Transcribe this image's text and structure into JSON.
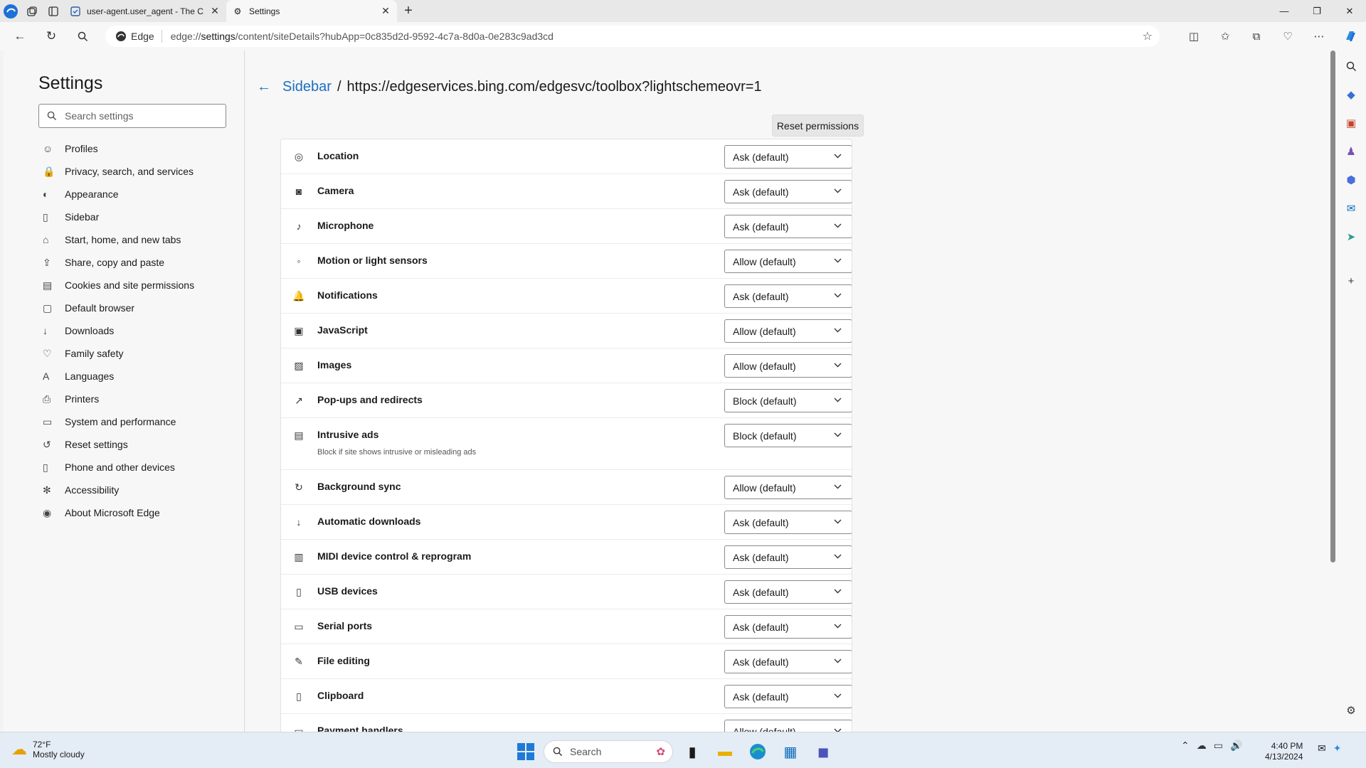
{
  "browser": {
    "tabs": [
      {
        "label": "user-agent.user_agent - The Coll",
        "active": false
      },
      {
        "label": "Settings",
        "active": true
      }
    ],
    "site_chip": "Edge",
    "url_prefix": "edge://",
    "url_host": "settings",
    "url_rest": "/content/siteDetails?hubApp=0c835d2d-9592-4c7a-8d0a-0e283c9ad3cd"
  },
  "settings": {
    "title": "Settings",
    "search_placeholder": "Search settings",
    "nav": [
      {
        "label": "Profiles",
        "icon": "profile-icon"
      },
      {
        "label": "Privacy, search, and services",
        "icon": "lock-icon"
      },
      {
        "label": "Appearance",
        "icon": "appearance-icon"
      },
      {
        "label": "Sidebar",
        "icon": "sidebar-icon"
      },
      {
        "label": "Start, home, and new tabs",
        "icon": "home-icon"
      },
      {
        "label": "Share, copy and paste",
        "icon": "share-icon"
      },
      {
        "label": "Cookies and site permissions",
        "icon": "cookies-icon"
      },
      {
        "label": "Default browser",
        "icon": "browser-icon"
      },
      {
        "label": "Downloads",
        "icon": "download-icon"
      },
      {
        "label": "Family safety",
        "icon": "family-icon"
      },
      {
        "label": "Languages",
        "icon": "languages-icon"
      },
      {
        "label": "Printers",
        "icon": "printer-icon"
      },
      {
        "label": "System and performance",
        "icon": "system-icon"
      },
      {
        "label": "Reset settings",
        "icon": "reset-icon"
      },
      {
        "label": "Phone and other devices",
        "icon": "phone-icon"
      },
      {
        "label": "Accessibility",
        "icon": "accessibility-icon"
      },
      {
        "label": "About Microsoft Edge",
        "icon": "edge-logo-icon"
      }
    ]
  },
  "main": {
    "breadcrumb_link": "Sidebar",
    "breadcrumb_sep": "/",
    "breadcrumb_current": "https://edgeservices.bing.com/edgesvc/toolbox?lightschemeovr=1",
    "reset_label": "Reset permissions",
    "permissions": [
      {
        "label": "Location",
        "value": "Ask (default)",
        "icon": "location-icon"
      },
      {
        "label": "Camera",
        "value": "Ask (default)",
        "icon": "camera-icon"
      },
      {
        "label": "Microphone",
        "value": "Ask (default)",
        "icon": "microphone-icon"
      },
      {
        "label": "Motion or light sensors",
        "value": "Allow (default)",
        "icon": "sensor-icon"
      },
      {
        "label": "Notifications",
        "value": "Ask (default)",
        "icon": "bell-icon"
      },
      {
        "label": "JavaScript",
        "value": "Allow (default)",
        "icon": "javascript-icon"
      },
      {
        "label": "Images",
        "value": "Allow (default)",
        "icon": "image-icon"
      },
      {
        "label": "Pop-ups and redirects",
        "value": "Block (default)",
        "icon": "popup-icon"
      },
      {
        "label": "Intrusive ads",
        "value": "Block (default)",
        "icon": "ads-icon",
        "sub": "Block if site shows intrusive or misleading ads"
      },
      {
        "label": "Background sync",
        "value": "Allow (default)",
        "icon": "sync-icon"
      },
      {
        "label": "Automatic downloads",
        "value": "Ask (default)",
        "icon": "download-icon"
      },
      {
        "label": "MIDI device control & reprogram",
        "value": "Ask (default)",
        "icon": "midi-icon"
      },
      {
        "label": "USB devices",
        "value": "Ask (default)",
        "icon": "usb-icon"
      },
      {
        "label": "Serial ports",
        "value": "Ask (default)",
        "icon": "serial-port-icon"
      },
      {
        "label": "File editing",
        "value": "Ask (default)",
        "icon": "file-edit-icon"
      },
      {
        "label": "Clipboard",
        "value": "Ask (default)",
        "icon": "clipboard-icon"
      },
      {
        "label": "Payment handlers",
        "value": "Allow (default)",
        "icon": "payment-icon"
      }
    ]
  },
  "taskbar": {
    "temperature": "72°F",
    "weather": "Mostly cloudy",
    "search_label": "Search",
    "time": "4:40 PM",
    "date": "4/13/2024"
  },
  "colors": {
    "accent": "#1b6ec2",
    "background": "#f7f7f7"
  }
}
